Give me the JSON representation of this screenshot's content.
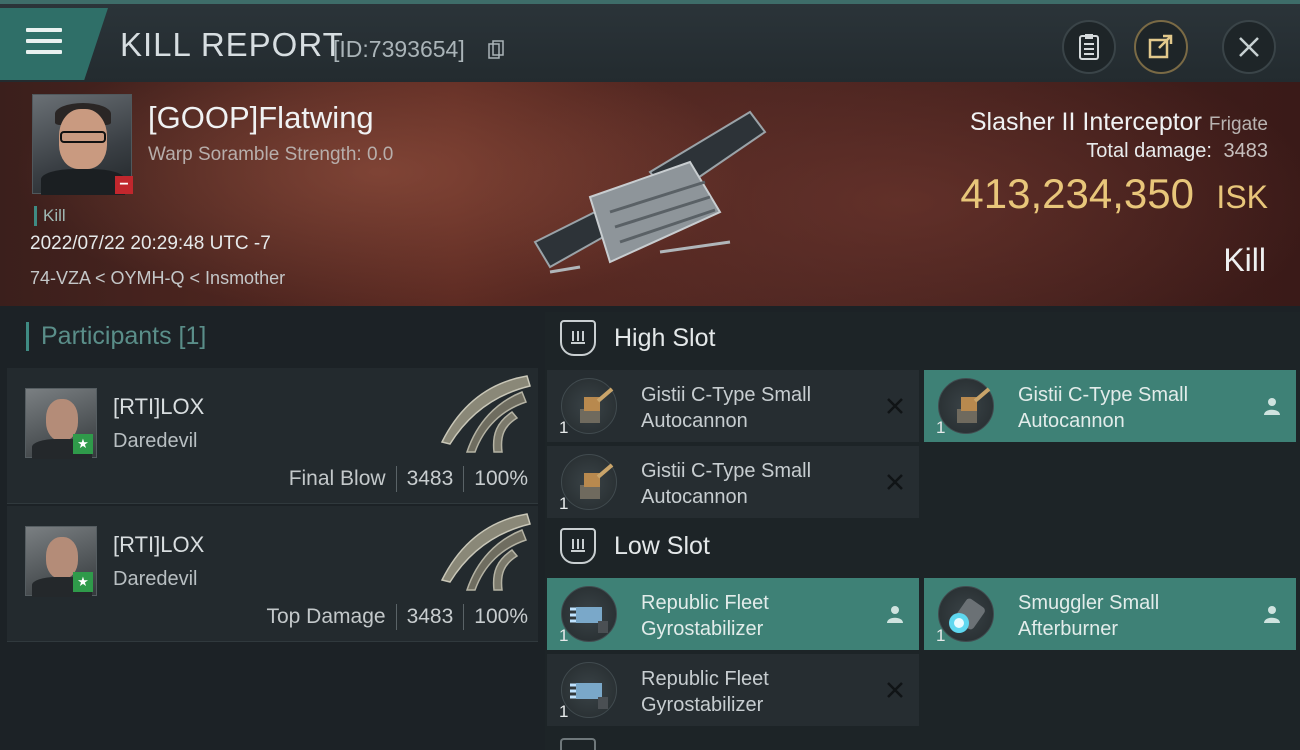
{
  "header": {
    "title": "KILL REPORT",
    "report_id": "[ID:7393654]",
    "icons": [
      "menu-icon",
      "copy-icon",
      "clipboard-icon",
      "share-icon",
      "close-icon"
    ]
  },
  "victim": {
    "name": "[GOOP]Flatwing",
    "warp_scramble": "Warp Soramble Strength: 0.0",
    "kill_tag": "Kill",
    "datetime": "2022/07/22 20:29:48 UTC -7",
    "location": "74-VZA < OYMH-Q < Insmother"
  },
  "ship": {
    "name": "Slasher II Interceptor",
    "class": "Frigate",
    "total_damage_label": "Total damage:",
    "total_damage": "3483",
    "isk_value": "413,234,350",
    "isk_unit": "ISK",
    "result": "Kill"
  },
  "participants": {
    "title": "Participants [1]",
    "list": [
      {
        "name": "[RTI]LOX",
        "ship": "Daredevil",
        "label": "Final Blow",
        "damage": "3483",
        "percent": "100%"
      },
      {
        "name": "[RTI]LOX",
        "ship": "Daredevil",
        "label": "Top Damage",
        "damage": "3483",
        "percent": "100%"
      }
    ]
  },
  "slots": {
    "high": {
      "title": "High Slot",
      "items": [
        {
          "qty": "1",
          "line1": "Gistii C-Type Small",
          "line2": "Autocannon",
          "state": "destroyed"
        },
        {
          "qty": "1",
          "line1": "Gistii C-Type Small",
          "line2": "Autocannon",
          "state": "dropped"
        },
        {
          "qty": "1",
          "line1": "Gistii C-Type Small",
          "line2": "Autocannon",
          "state": "destroyed"
        }
      ]
    },
    "low": {
      "title": "Low Slot",
      "items": [
        {
          "qty": "1",
          "line1": "Republic Fleet",
          "line2": "Gyrostabilizer",
          "state": "dropped"
        },
        {
          "qty": "1",
          "line1": "Smuggler Small",
          "line2": "Afterburner",
          "state": "dropped"
        },
        {
          "qty": "1",
          "line1": "Republic Fleet",
          "line2": "Gyrostabilizer",
          "state": "destroyed"
        }
      ]
    }
  },
  "colors": {
    "accent": "#3e8176",
    "isk": "#e8c67a",
    "kill_badge": "#c1272d",
    "ally_badge": "#2f9a4a"
  }
}
